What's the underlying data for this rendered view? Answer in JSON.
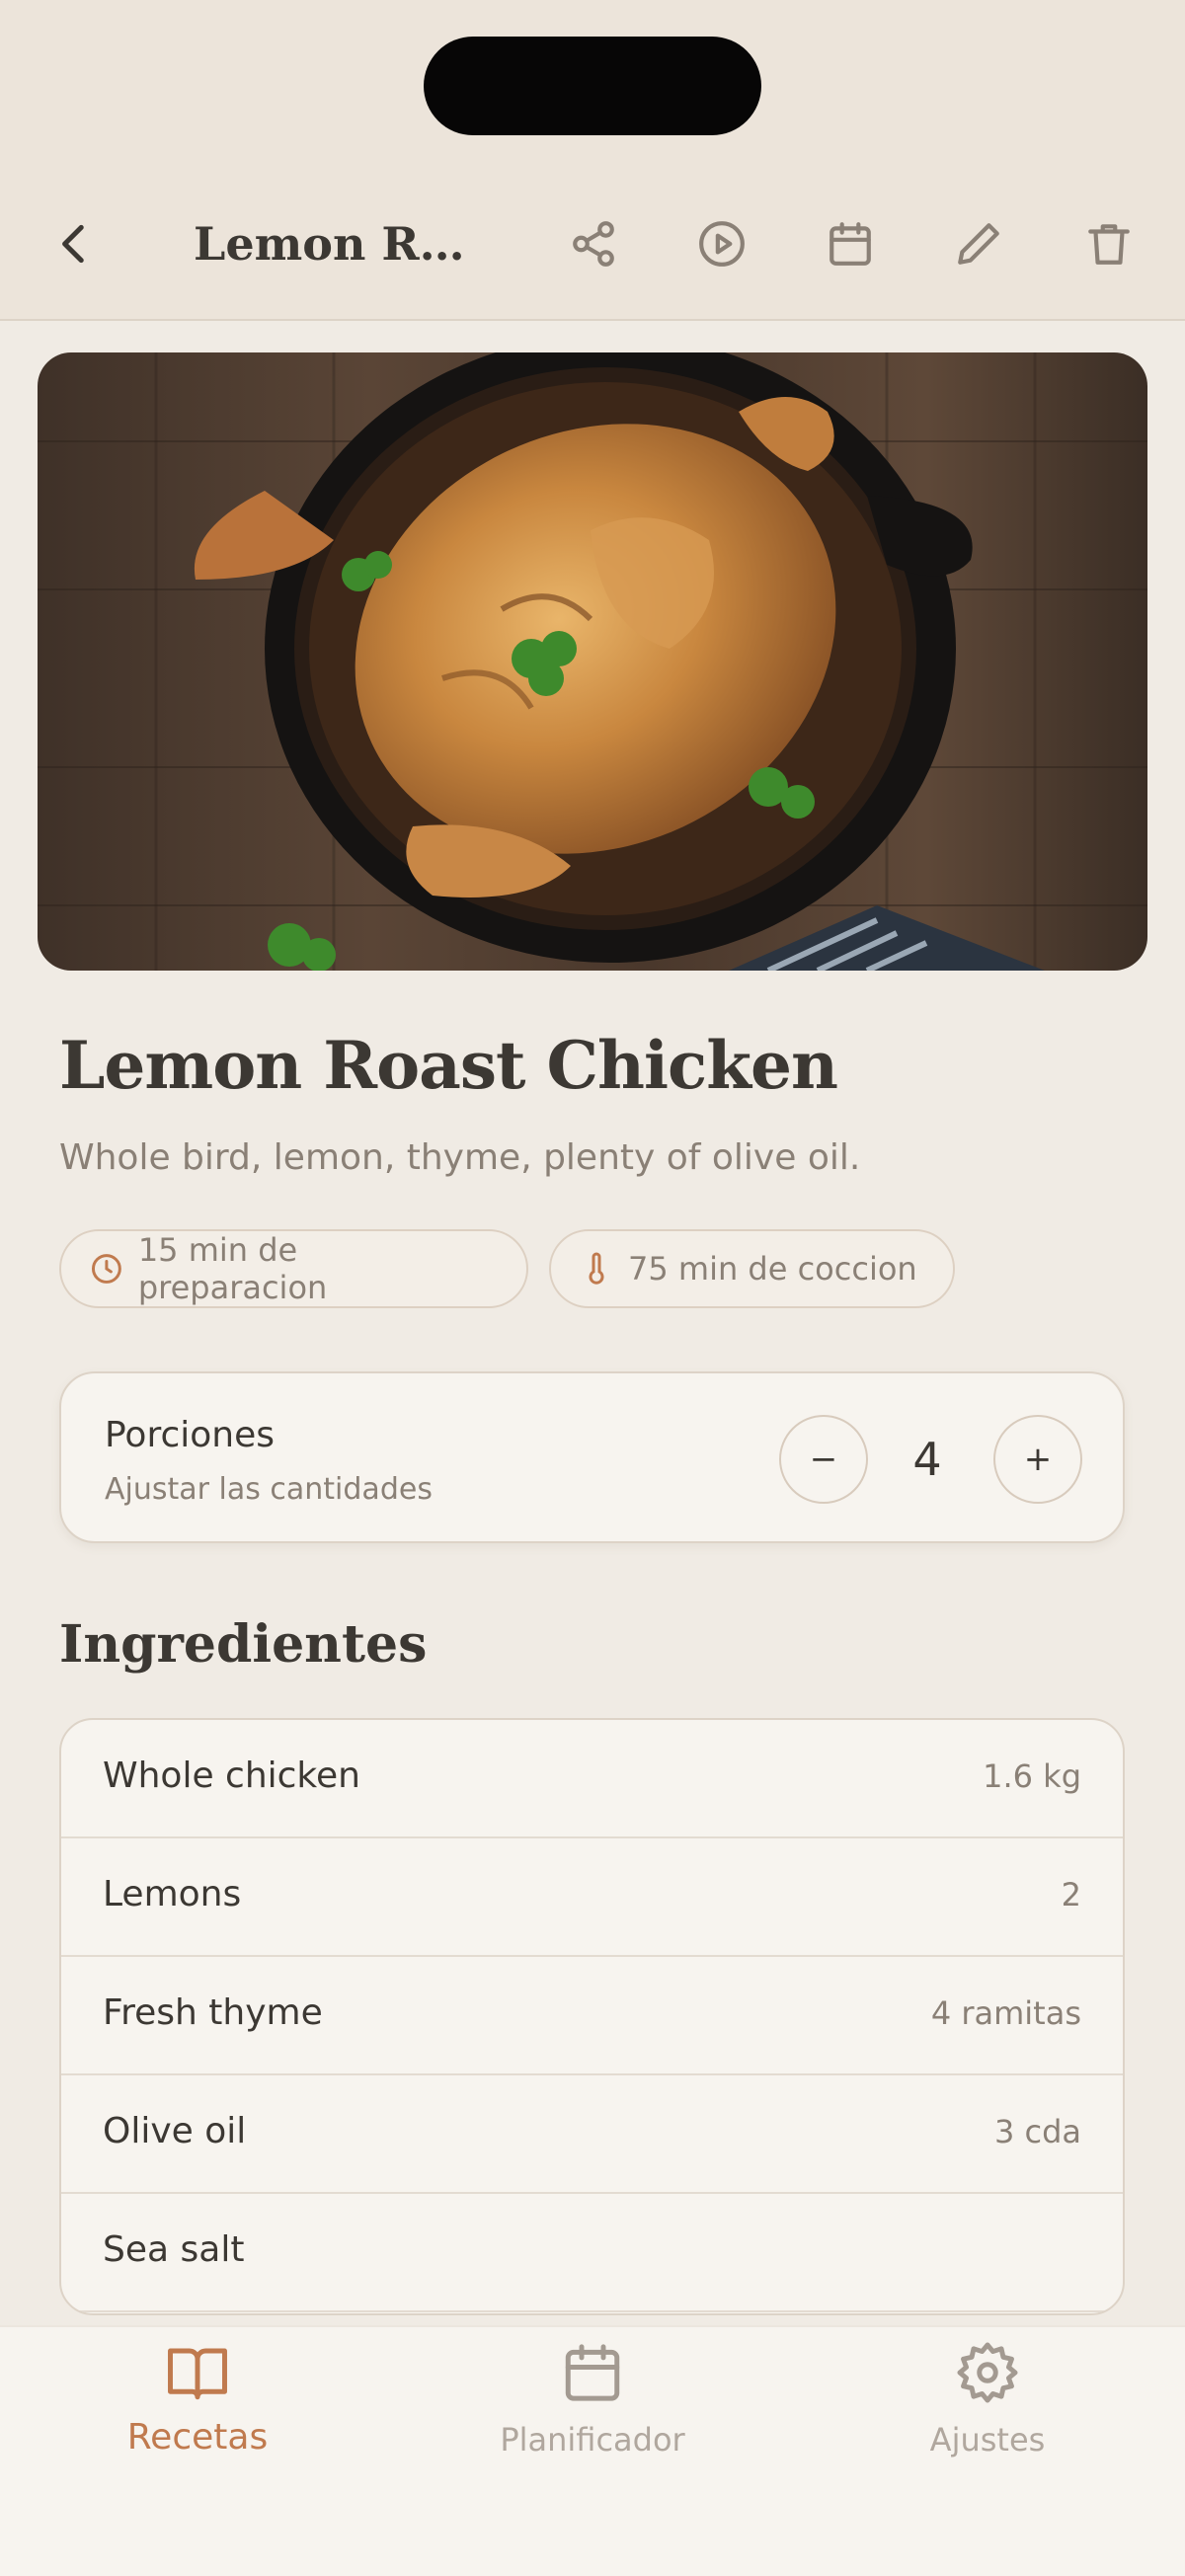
{
  "header": {
    "title": "Lemon Roast Chicken"
  },
  "recipe": {
    "title": "Lemon Roast Chicken",
    "description": "Whole bird, lemon, thyme, plenty of olive oil.",
    "prep_chip": "15 min de preparacion",
    "cook_chip": "75 min de coccion"
  },
  "servings": {
    "label": "Porciones",
    "hint": "Ajustar las cantidades",
    "minus": "−",
    "value": "4",
    "plus": "+"
  },
  "ingredients": {
    "title": "Ingredientes",
    "items": [
      {
        "name": "Whole chicken",
        "qty": "1.6 kg"
      },
      {
        "name": "Lemons",
        "qty": "2"
      },
      {
        "name": "Fresh thyme",
        "qty": "4 ramitas"
      },
      {
        "name": "Olive oil",
        "qty": "3 cda"
      },
      {
        "name": "Sea salt",
        "qty": ""
      }
    ]
  },
  "tabs": [
    {
      "label": "Recetas",
      "icon": "book-icon",
      "active": true
    },
    {
      "label": "Planificador",
      "icon": "calendar-icon",
      "active": false
    },
    {
      "label": "Ajustes",
      "icon": "gear-icon",
      "active": false
    }
  ],
  "icons": [
    "back-icon",
    "share-icon",
    "play-icon",
    "calendar-icon",
    "edit-icon",
    "trash-icon",
    "clock-icon",
    "thermometer-icon"
  ],
  "colors": {
    "accent": "#c07a4e",
    "background": "#f0ebe4",
    "text": "#3c3833",
    "muted": "#8a8076"
  }
}
